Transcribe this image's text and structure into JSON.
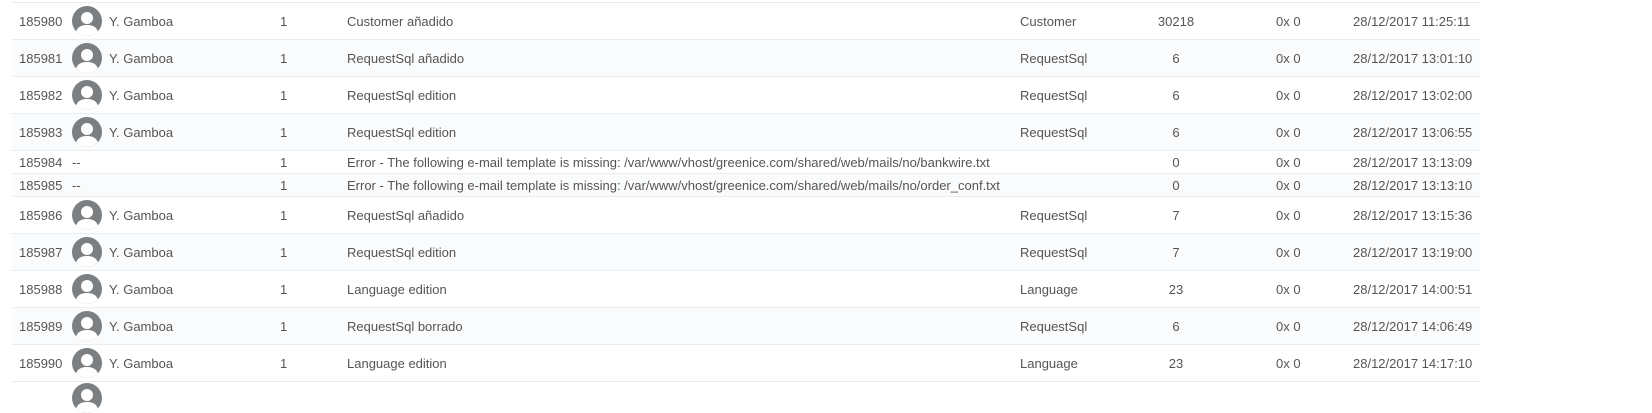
{
  "rows": [
    {
      "id": "185980",
      "employee": "Y. Gamboa",
      "has_avatar": true,
      "shop": "1",
      "message": "Customer añadido",
      "object_type": "Customer",
      "object_id": "30218",
      "error": "0x 0",
      "date": "28/12/2017 11:25:11"
    },
    {
      "id": "185981",
      "employee": "Y. Gamboa",
      "has_avatar": true,
      "shop": "1",
      "message": "RequestSql añadido",
      "object_type": "RequestSql",
      "object_id": "6",
      "error": "0x 0",
      "date": "28/12/2017 13:01:10"
    },
    {
      "id": "185982",
      "employee": "Y. Gamboa",
      "has_avatar": true,
      "shop": "1",
      "message": "RequestSql edition",
      "object_type": "RequestSql",
      "object_id": "6",
      "error": "0x 0",
      "date": "28/12/2017 13:02:00"
    },
    {
      "id": "185983",
      "employee": "Y. Gamboa",
      "has_avatar": true,
      "shop": "1",
      "message": "RequestSql edition",
      "object_type": "RequestSql",
      "object_id": "6",
      "error": "0x 0",
      "date": "28/12/2017 13:06:55"
    },
    {
      "id": "185984",
      "employee": "--",
      "has_avatar": false,
      "shop": "1",
      "message": "Error - The following e-mail template is missing: /var/www/vhost/greenice.com/shared/web/mails/no/bankwire.txt",
      "object_type": "",
      "object_id": "0",
      "error": "0x 0",
      "date": "28/12/2017 13:13:09"
    },
    {
      "id": "185985",
      "employee": "--",
      "has_avatar": false,
      "shop": "1",
      "message": "Error - The following e-mail template is missing: /var/www/vhost/greenice.com/shared/web/mails/no/order_conf.txt",
      "object_type": "",
      "object_id": "0",
      "error": "0x 0",
      "date": "28/12/2017 13:13:10"
    },
    {
      "id": "185986",
      "employee": "Y. Gamboa",
      "has_avatar": true,
      "shop": "1",
      "message": "RequestSql añadido",
      "object_type": "RequestSql",
      "object_id": "7",
      "error": "0x 0",
      "date": "28/12/2017 13:15:36"
    },
    {
      "id": "185987",
      "employee": "Y. Gamboa",
      "has_avatar": true,
      "shop": "1",
      "message": "RequestSql edition",
      "object_type": "RequestSql",
      "object_id": "7",
      "error": "0x 0",
      "date": "28/12/2017 13:19:00"
    },
    {
      "id": "185988",
      "employee": "Y. Gamboa",
      "has_avatar": true,
      "shop": "1",
      "message": "Language edition",
      "object_type": "Language",
      "object_id": "23",
      "error": "0x 0",
      "date": "28/12/2017 14:00:51"
    },
    {
      "id": "185989",
      "employee": "Y. Gamboa",
      "has_avatar": true,
      "shop": "1",
      "message": "RequestSql borrado",
      "object_type": "RequestSql",
      "object_id": "6",
      "error": "0x 0",
      "date": "28/12/2017 14:06:49"
    },
    {
      "id": "185990",
      "employee": "Y. Gamboa",
      "has_avatar": true,
      "shop": "1",
      "message": "Language edition",
      "object_type": "Language",
      "object_id": "23",
      "error": "0x 0",
      "date": "28/12/2017 14:17:10"
    }
  ],
  "icons": {
    "avatar": "user-avatar-icon"
  },
  "colors": {
    "avatar_bg": "#7c7f82",
    "row_border": "#e8edf0",
    "text": "#555555"
  }
}
